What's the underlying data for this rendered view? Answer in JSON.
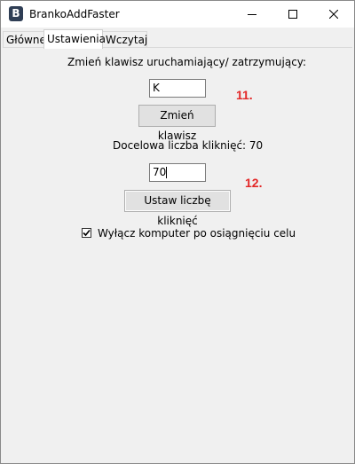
{
  "window": {
    "title": "BrankoAddFaster",
    "icon": "app-logo-icon",
    "icon_letter": "B",
    "controls": [
      "minimize-icon",
      "maximize-icon",
      "close-icon"
    ]
  },
  "tabs": [
    {
      "label": "Główne",
      "active": false
    },
    {
      "label": "Ustawienia",
      "active": true
    },
    {
      "label": "Wczytaj",
      "active": false
    }
  ],
  "settings": {
    "key_label": "Zmień klawisz uruchamiający/ zatrzymujący:",
    "key_value": "K",
    "change_key_button": "Zmień klawisz",
    "clicks_label": "Docelowa liczba kliknięć: 70",
    "clicks_value": "70",
    "set_clicks_button": "Ustaw liczbę kliknięć",
    "shutdown_checkbox_label": "Wyłącz komputer po osiągnięciu celu",
    "shutdown_checked": true
  },
  "annotations": {
    "first": "11.",
    "second": "12.",
    "color": "#e32626"
  }
}
